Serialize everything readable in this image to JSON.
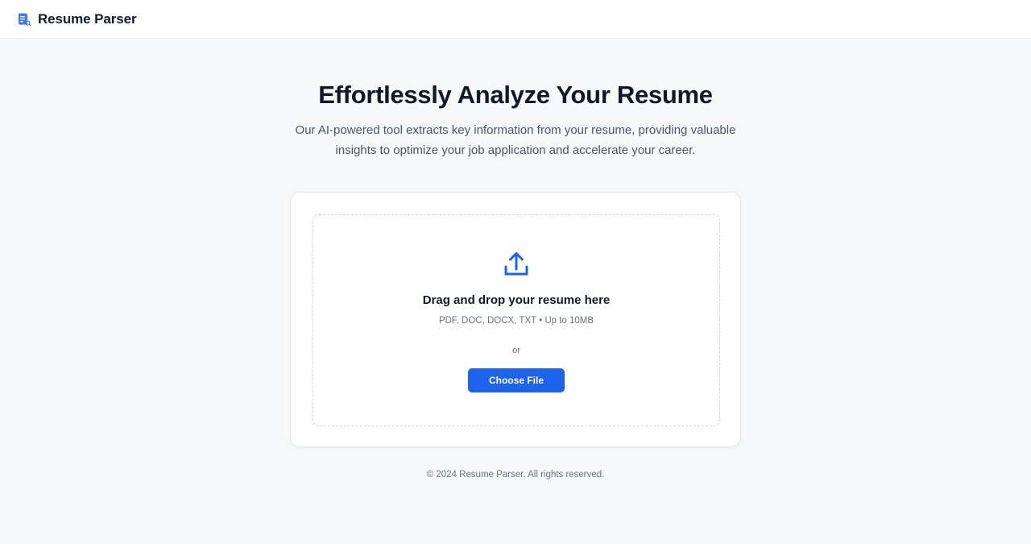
{
  "header": {
    "app_name": "Resume Parser",
    "logo_icon": "document-icon"
  },
  "hero": {
    "title": "Effortlessly Analyze Your Resume",
    "subtitle": "Our AI-powered tool extracts key information from your resume, providing valuable insights to optimize your job application and accelerate your career."
  },
  "upload": {
    "icon": "upload-icon",
    "title": "Drag and drop your resume here",
    "formats": "PDF, DOC, DOCX, TXT • Up to 10MB",
    "divider": "or",
    "button_label": "Choose File"
  },
  "footer": {
    "copyright": "© 2024 Resume Parser. All rights reserved."
  },
  "colors": {
    "accent": "#1d63ed",
    "background": "#f7f8fa",
    "heading": "#111827",
    "muted": "#6b7280"
  }
}
